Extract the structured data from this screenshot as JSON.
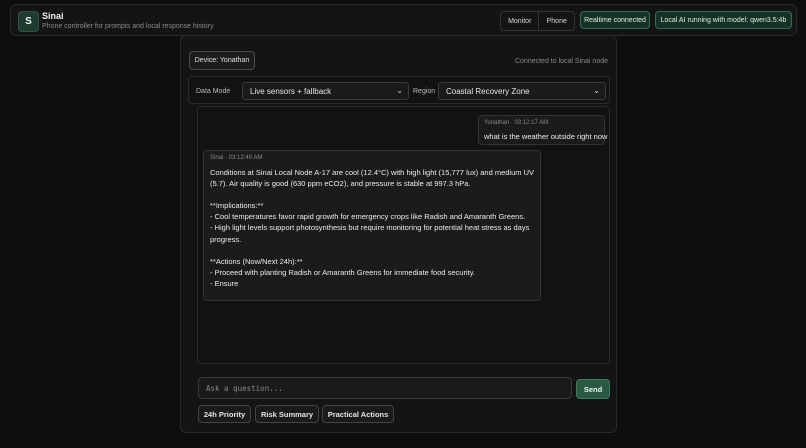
{
  "header": {
    "logo_letter": "S",
    "title": "Sinai",
    "subtitle": "Phone controller for prompts and local response history",
    "tabs": [
      "Monitor",
      "Phone"
    ],
    "status_realtime": "Realtime connected",
    "status_model": "Local AI running with model: qwen3.5:4b"
  },
  "panel": {
    "device_label": "Device: Yonathan",
    "connection_text": "Connected to local Sinai node",
    "data_mode_label": "Data Mode",
    "data_mode_value": "Live sensors + fallback",
    "region_label": "Region",
    "region_value": "Coastal Recovery Zone"
  },
  "messages": [
    {
      "role": "user",
      "meta": "Yonathan · 03:12:17 AM",
      "text": "what is the weather outside right now"
    },
    {
      "role": "assistant",
      "meta": "Sinai · 03:12:49 AM",
      "text": "Conditions at Sinai Local Node A-17 are cool (12.4°C) with high light (15,777 lux) and medium UV (5.7). Air quality is good (630 ppm eCO2), and pressure is stable at 997.3 hPa.\n\n**Implications:**\n- Cool temperatures favor rapid growth for emergency crops like Radish and Amaranth Greens.\n- High light levels support photosynthesis but require monitoring for potential heat stress as days progress.\n\n**Actions (Now/Next 24h):**\n- Proceed with planting Radish or Amaranth Greens for immediate food security.\n- Ensure"
    }
  ],
  "composer": {
    "placeholder": "Ask a question...",
    "send_label": "Send",
    "quick_actions": [
      "24h Priority",
      "Risk Summary",
      "Practical Actions"
    ]
  }
}
